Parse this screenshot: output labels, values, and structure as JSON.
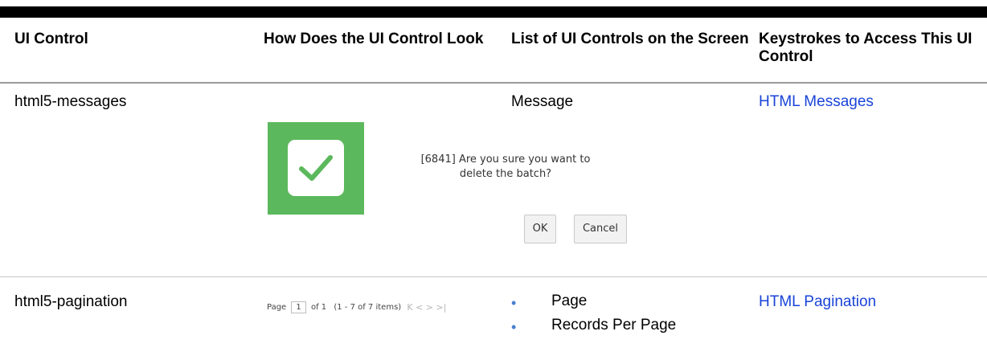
{
  "table": {
    "headers": [
      "UI Control",
      "How Does the UI Control Look",
      "List of UI Controls on the Screen",
      "Keystrokes to Access This UI Control"
    ],
    "rows": [
      {
        "control": "html5-messages",
        "controls_list": [
          "Message"
        ],
        "keystrokes_link": "HTML Messages",
        "preview": {
          "message_line1": "[6841] Are you sure you want to",
          "message_line2": "delete the batch?",
          "ok_label": "OK",
          "cancel_label": "Cancel"
        }
      },
      {
        "control": "html5-pagination",
        "controls_list": [
          "Page",
          "Records Per Page"
        ],
        "keystrokes_link": "HTML Pagination",
        "preview": {
          "page_label": "Page",
          "page_value": "1",
          "of_label": "of 1",
          "items_label": "(1 - 7 of  7  items)",
          "nav_glyphs": "K < > >|"
        }
      }
    ]
  },
  "colors": {
    "link": "#1a44d8",
    "success_tile": "#5cb85c",
    "bullet": "#4a7fd0"
  }
}
